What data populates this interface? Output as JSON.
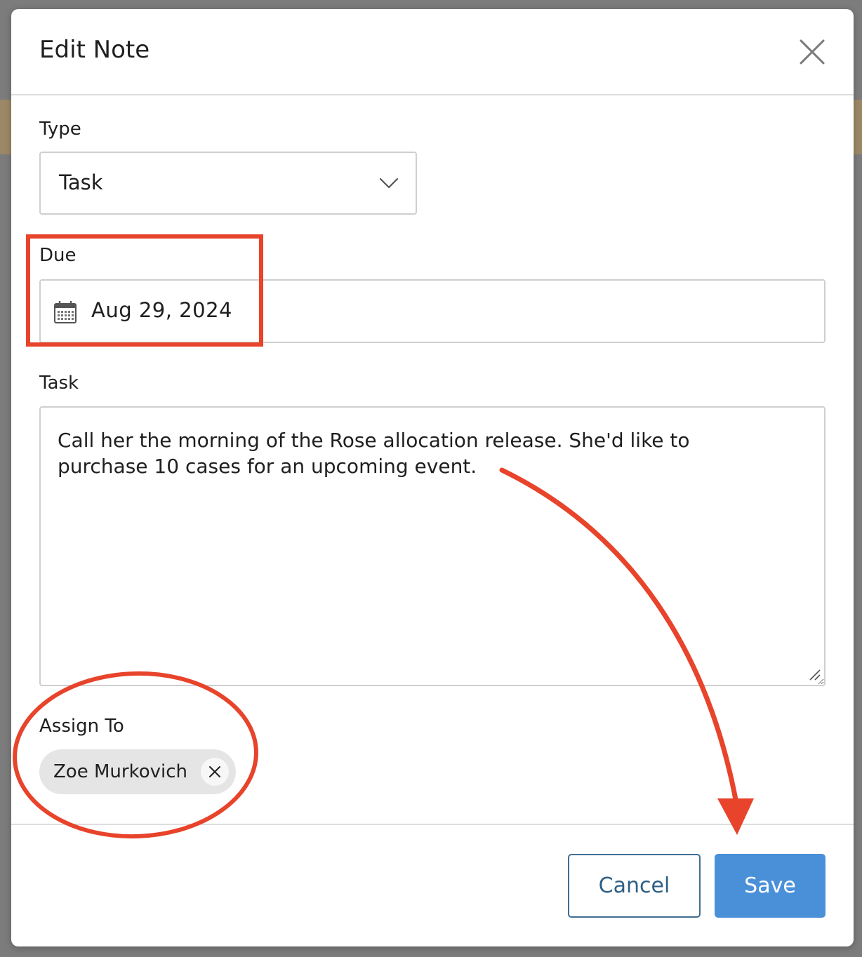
{
  "modal": {
    "title": "Edit Note",
    "close_icon": "close-icon"
  },
  "form": {
    "type": {
      "label": "Type",
      "value": "Task",
      "icon": "chevron-down-icon"
    },
    "due": {
      "label": "Due",
      "value": "Aug 29, 2024",
      "icon": "calendar-icon"
    },
    "task": {
      "label": "Task",
      "value": "Call her the morning of the Rose allocation release. She'd like to\npurchase 10 cases for an upcoming event."
    },
    "assign_to": {
      "label": "Assign To",
      "assignees": [
        {
          "name": "Zoe Murkovich",
          "remove_icon": "close-icon"
        }
      ]
    }
  },
  "footer": {
    "cancel_label": "Cancel",
    "save_label": "Save"
  },
  "colors": {
    "primary": "#4a90d9",
    "cancel_border": "#3f6f93",
    "annotation": "#e8432b",
    "chip_bg": "#e5e5e5"
  }
}
